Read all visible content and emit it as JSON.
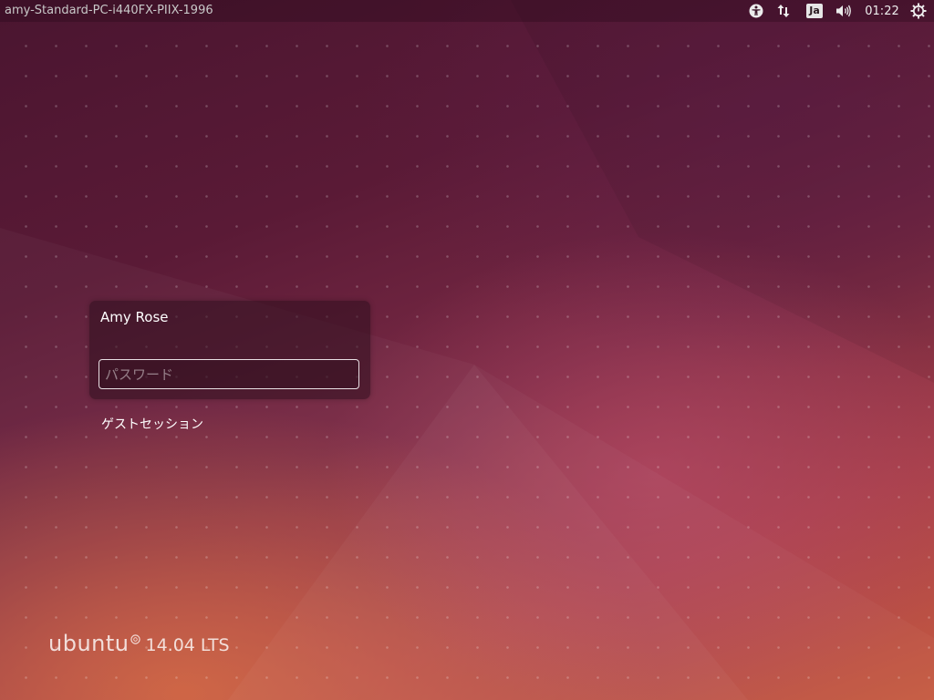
{
  "top_panel": {
    "hostname": "amy-Standard-PC-i440FX-PIIX-1996",
    "keyboard_layout": "Ja",
    "clock": "01:22",
    "icons": {
      "accessibility": "accessibility-icon",
      "network": "network-arrows-icon",
      "sound": "speaker-volume-icon",
      "session": "power-gear-icon"
    }
  },
  "login": {
    "user_name": "Amy Rose",
    "password_value": "",
    "password_placeholder": "パスワード",
    "guest_session": "ゲストセッション"
  },
  "branding": {
    "wordmark": "ubuntu",
    "version": "14.04 LTS"
  },
  "colors": {
    "background_dark": "#4a1530",
    "background_warm": "#c65a40",
    "text": "#ffffff"
  }
}
